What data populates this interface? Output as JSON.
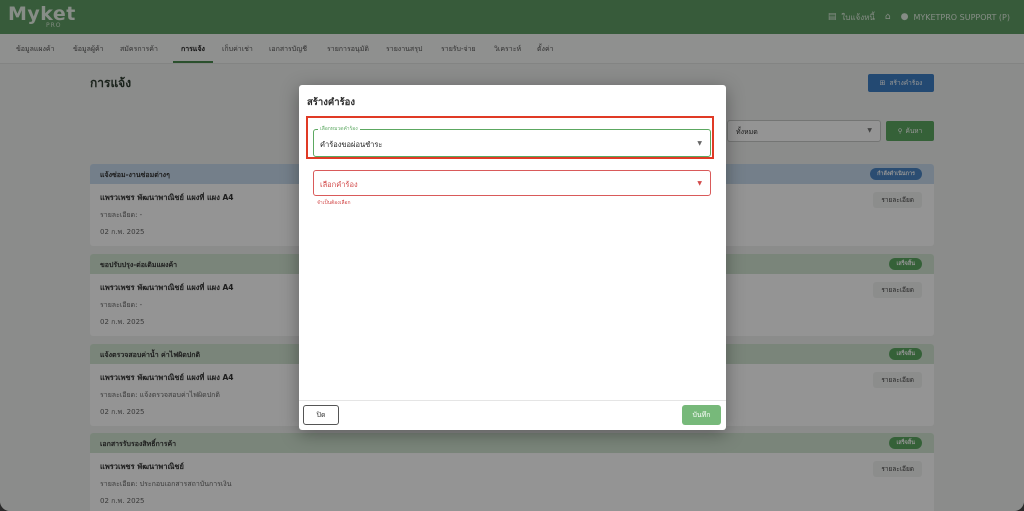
{
  "app": {
    "logo": "Myket",
    "logo_sub": "PRO"
  },
  "topbar": {
    "invoice_label": "ใบแจ้งหนี้",
    "user_label": "MYKETPRO SUPPORT (P)",
    "icons": [
      "receipt-icon",
      "home-icon",
      "user-icon"
    ]
  },
  "nav": {
    "tabs": [
      {
        "label": "ข้อมูลแผงค้า"
      },
      {
        "label": "ข้อมูลผู้ค้า"
      },
      {
        "label": "สมัครการค้า"
      },
      {
        "label": "การแจ้ง"
      },
      {
        "label": "เก็บค่าเช่า"
      },
      {
        "label": "เอกสารบัญชี"
      },
      {
        "label": "รายการอนุมัติ"
      },
      {
        "label": "รายงานสรุป"
      },
      {
        "label": "รายรับ-จ่าย"
      },
      {
        "label": "วิเคราะห์"
      },
      {
        "label": "ตั้งค่า"
      }
    ],
    "active": "การแจ้ง"
  },
  "page": {
    "title": "การแจ้ง",
    "create_button": "สร้างคำร้อง",
    "filter_value": "ทั้งหมด",
    "search_button": "ค้นหา"
  },
  "cards": [
    {
      "header": "แจ้งซ่อม-งานซ่อมต่างๆ",
      "badge": "กำลังดำเนินการ",
      "color": "blue",
      "line1": "แพรวเพชร พัฒนาพาณิชย์ แผงที่ แผง A4",
      "line2": "รายละเอียด: -",
      "line3": "02 ก.พ. 2025",
      "detail": "รายละเอียด"
    },
    {
      "header": "ขอปรับปรุง-ต่อเติมแผงค้า",
      "badge": "เสร็จสิ้น",
      "color": "green",
      "line1": "แพรวเพชร พัฒนาพาณิชย์ แผงที่ แผง A4",
      "line2": "รายละเอียด: -",
      "line3": "02 ก.พ. 2025",
      "detail": "รายละเอียด"
    },
    {
      "header": "แจ้งตรวจสอบค่าน้ำ ค่าไฟผิดปกติ",
      "badge": "เสร็จสิ้น",
      "color": "green",
      "line1": "แพรวเพชร พัฒนาพาณิชย์ แผงที่ แผง A4",
      "line2": "รายละเอียด: แจ้งตรวจสอบค่าไฟผิดปกติ",
      "line3": "02 ก.พ. 2025",
      "detail": "รายละเอียด"
    },
    {
      "header": "เอกสารรับรองสิทธิ์การค้า",
      "badge": "เสร็จสิ้น",
      "color": "green",
      "line1": "แพรวเพชร พัฒนาพาณิชย์",
      "line2": "รายละเอียด: ประกอบเอกสารสถาบันการเงิน",
      "line3": "02 ก.พ. 2025",
      "detail": "รายละเอียด"
    }
  ],
  "modal": {
    "title": "สร้างคำร้อง",
    "category_label": "เลือกหมวดคำร้อง",
    "category_value": "คำร้องขอผ่อนชำระ",
    "request_placeholder": "เลือกคำร้อง",
    "request_error": "จำเป็นต้องเลือก",
    "close_button": "ปิด",
    "save_button": "บันทึก"
  },
  "colors": {
    "brand_green": "#5f9e64",
    "primary_blue": "#3d7fc4",
    "success_green": "#5ca861",
    "error_red": "#d24a4a",
    "highlight_red": "#e03a25"
  }
}
